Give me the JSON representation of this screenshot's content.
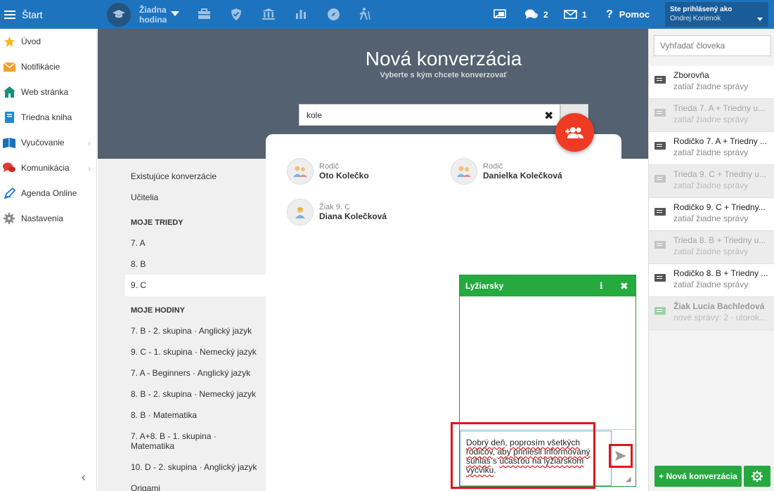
{
  "topbar": {
    "start_label": "Štart",
    "hodina_line1": "Žiadna",
    "hodina_line2": "hodina",
    "chat_count": "2",
    "mail_count": "1",
    "help_label": "Pomoc",
    "user_line1": "Ste prihlásený ako",
    "user_line2": "Ondrej Korienok"
  },
  "sidebar": {
    "items": [
      {
        "label": "Úvod",
        "icon": "star-icon"
      },
      {
        "label": "Notifikácie",
        "icon": "envelope-icon"
      },
      {
        "label": "Web stránka",
        "icon": "home-icon"
      },
      {
        "label": "Triedna kniha",
        "icon": "book-icon"
      },
      {
        "label": "Vyučovanie",
        "icon": "school-book-icon"
      },
      {
        "label": "Komunikácia",
        "icon": "chat-bubbles-icon"
      },
      {
        "label": "Agenda Online",
        "icon": "pen-icon"
      },
      {
        "label": "Nastavenia",
        "icon": "gear-icon"
      }
    ]
  },
  "header": {
    "title": "Nová konverzácia",
    "subtitle": "Vyberte s kým chcete konverzovať",
    "search_value": "kole"
  },
  "left_list": {
    "existing": "Existujúce konverzácie",
    "teachers": "Učitelia",
    "classes_header": "MOJE TRIEDY",
    "classes": [
      "7. A",
      "8. B",
      "9. C"
    ],
    "lessons_header": "MOJE HODINY",
    "lessons": [
      "7. B - 2. skupina · Anglický jazyk",
      "9. C - 1. skupina · Nemecký jazyk",
      "7. A - Beginners · Anglický jazyk",
      "8. B - 2. skupina · Nemecký jazyk",
      "8. B · Matematika",
      "7. A+8. B - 1. skupina ·",
      "Matematika",
      "10. D - 2. skupina · Anglický jazyk",
      "Origami"
    ]
  },
  "results": [
    {
      "role": "Rodič",
      "name": "Oto Kolečko"
    },
    {
      "role": "Rodič",
      "name": "Danielka Kolečková"
    },
    {
      "role": "Žiak 9. C",
      "name": "Diana Kolečková"
    }
  ],
  "chat": {
    "title": "Lyžiarsky",
    "info": "i",
    "close": "✖",
    "text_parts": [
      "Dobrý deň, poprosím všetkých rodičov, aby priniesli informovaný súhlas s účasťou na lyžiarskom výcviku."
    ],
    "text_l1a": "Dobrý deň",
    "text_l1b": ", ",
    "text_l1c": "poprosím všetkých",
    "text_l2a": "rodičov",
    "text_l2b": ", ",
    "text_l2c": "aby priniesli informovaný",
    "text_l3a": "súhlas",
    "text_l3b": " s ",
    "text_l3c": "účasťou na lyžiarskom",
    "text_l4a": "výcviku",
    "text_l4b": "."
  },
  "right_panel": {
    "search_placeholder": "Vyhľadať človeka",
    "conversations": [
      {
        "name": "Zborovňa",
        "sub": "zatiaľ žiadne správy",
        "state": "on"
      },
      {
        "name": "Trieda 7. A + Triedny u...",
        "sub": "zatiaľ žiadne správy",
        "state": "off"
      },
      {
        "name": "Rodičko 7. A + Triedny ...",
        "sub": "zatiaľ žiadne správy",
        "state": "on"
      },
      {
        "name": "Trieda 9. C + Triedny u...",
        "sub": "zatiaľ žiadne správy",
        "state": "off"
      },
      {
        "name": "Rodičko 9. C + Triedny...",
        "sub": "zatiaľ žiadne správy",
        "state": "on"
      },
      {
        "name": "Trieda 8. B + Triedny u...",
        "sub": "zatiaľ žiadne správy",
        "state": "off"
      },
      {
        "name": "Rodičko 8. B + Triedny ...",
        "sub": "zatiaľ žiadne správy",
        "state": "on"
      },
      {
        "name": "Žiak Lucia Bachledová",
        "sub": "nové správy: 2 · utorok...",
        "state": "new"
      }
    ],
    "new_conversation": "+ Nová konverzácia"
  },
  "colors": {
    "topbar": "#1e73be",
    "header": "#536170",
    "green": "#26a93f",
    "fab": "#ef3b24",
    "highlight": "#e1151a"
  }
}
